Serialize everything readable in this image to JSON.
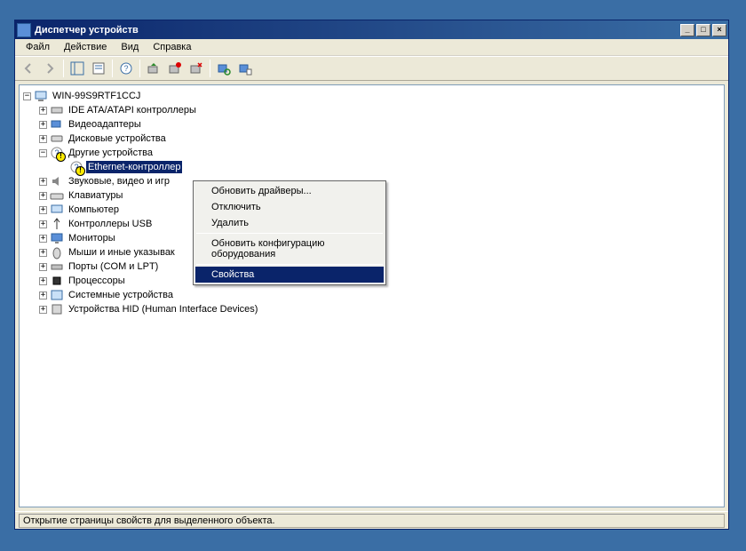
{
  "window": {
    "title": "Диспетчер устройств"
  },
  "menu": {
    "file": "Файл",
    "action": "Действие",
    "view": "Вид",
    "help": "Справка"
  },
  "tree": {
    "root": "WIN-99S9RTF1CCJ",
    "items": [
      {
        "label": "IDE ATA/ATAPI контроллеры",
        "icon": "ide"
      },
      {
        "label": "Видеоадаптеры",
        "icon": "display"
      },
      {
        "label": "Дисковые устройства",
        "icon": "disk"
      },
      {
        "label": "Другие устройства",
        "icon": "unknown",
        "expanded": true,
        "children": [
          {
            "label": "Ethernet-контроллер",
            "icon": "unknown-warn",
            "selected": true
          }
        ]
      },
      {
        "label": "Звуковые, видео и игр",
        "icon": "sound"
      },
      {
        "label": "Клавиатуры",
        "icon": "keyboard"
      },
      {
        "label": "Компьютер",
        "icon": "computer"
      },
      {
        "label": "Контроллеры USB",
        "icon": "usb"
      },
      {
        "label": "Мониторы",
        "icon": "monitor"
      },
      {
        "label": "Мыши и иные указывак",
        "icon": "mouse"
      },
      {
        "label": "Порты (COM и LPT)",
        "icon": "port"
      },
      {
        "label": "Процессоры",
        "icon": "cpu"
      },
      {
        "label": "Системные устройства",
        "icon": "system"
      },
      {
        "label": "Устройства HID (Human Interface Devices)",
        "icon": "hid"
      }
    ]
  },
  "context_menu": {
    "update_drivers": "Обновить драйверы...",
    "disable": "Отключить",
    "delete": "Удалить",
    "scan_hw": "Обновить конфигурацию оборудования",
    "properties": "Свойства"
  },
  "statusbar": {
    "text": "Открытие страницы свойств для выделенного объекта."
  }
}
